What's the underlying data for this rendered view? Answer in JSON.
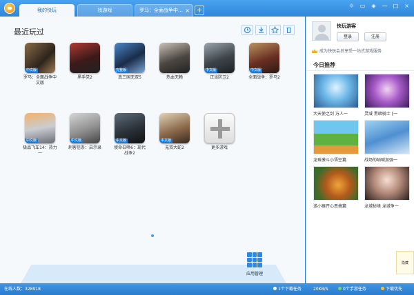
{
  "tabs": [
    {
      "label": "我的快玩",
      "active": true
    },
    {
      "label": "找游戏",
      "active": false
    },
    {
      "label": "罗马：全面战争中…",
      "active": false,
      "close": "×"
    }
  ],
  "tab_add": "+",
  "window_controls": [
    "☼",
    "▭",
    "◈",
    "—",
    "□",
    "×"
  ],
  "main": {
    "title": "最近玩过",
    "games": [
      {
        "label": "罗马：全面战争中文版",
        "badge": "中文版"
      },
      {
        "label": "黑手党2",
        "badge": ""
      },
      {
        "label": "真三国无双5",
        "badge": "完整版"
      },
      {
        "label": "热血无赖",
        "badge": ""
      },
      {
        "label": "正当防卫2",
        "badge": "中文版"
      },
      {
        "label": "全面战争：罗马2",
        "badge": "中文版"
      },
      {
        "label": "极品飞车14：热力一",
        "badge": "中文版"
      },
      {
        "label": "刺客信条：启示录",
        "badge": "中文版"
      },
      {
        "label": "使命召唤6：现代战争2",
        "badge": "中文版"
      },
      {
        "label": "无双大蛇2",
        "badge": "中文版"
      },
      {
        "label": "更多游戏",
        "badge": ""
      }
    ],
    "app_manage": "应用管理"
  },
  "side": {
    "username": "快玩游客",
    "login": "登录",
    "register": "注册",
    "member_text": "成为快玩会员享受一站式游戏服务",
    "today_title": "今日推荐",
    "recs": [
      {
        "label": "大天使之剑  万人一"
      },
      {
        "label": "灵域  黑暗骑士  [一"
      },
      {
        "label": "龙珠激斗小悟空篇"
      },
      {
        "label": "战场的呐喊加强一"
      },
      {
        "label": "送小猴开心恶搞篇"
      },
      {
        "label": "龙城秘境  龙城争一"
      }
    ],
    "tip": "隐藏"
  },
  "status": {
    "online": "在线人数：328918",
    "downloads": "1个下载任务",
    "speed": "20KB/S",
    "mobile": "0个手游任务",
    "priority": "下载优先"
  },
  "colors": {
    "accent": "#2f86da",
    "badge": "#1b7bd8"
  }
}
